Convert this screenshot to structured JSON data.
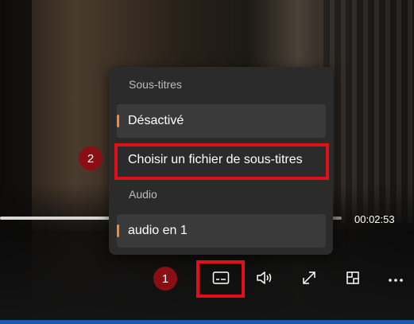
{
  "menu": {
    "subtitles_heading": "Sous-titres",
    "subtitles_off": "Désactivé",
    "choose_subtitle_file": "Choisir un fichier de sous-titres",
    "audio_heading": "Audio",
    "audio_track": "audio en 1"
  },
  "player": {
    "time": "00:02:53"
  },
  "annotations": {
    "badge_1": "1",
    "badge_2": "2"
  },
  "icons": [
    "subtitles-icon",
    "volume-icon",
    "fullscreen-icon",
    "mini-player-icon",
    "more-icon"
  ],
  "colors": {
    "accent": "#f0893c",
    "highlight": "#e0101b",
    "badge": "#8a0f15"
  }
}
